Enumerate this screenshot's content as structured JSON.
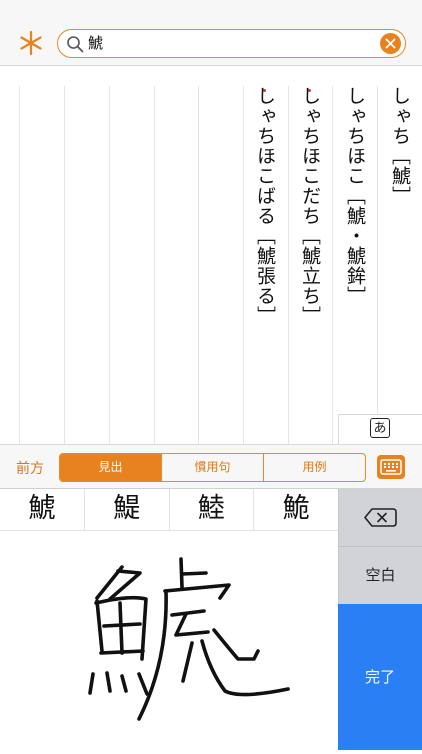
{
  "search": {
    "query": "鯱"
  },
  "entries": [
    {
      "text": "しゃち［鯱］",
      "marked": false
    },
    {
      "text": "しゃちほこ［鯱・鯱鉾］",
      "marked": false
    },
    {
      "text": "しゃちほこだち［鯱立ち］",
      "marked": true
    },
    {
      "text": "しゃちほこばる［鯱張る］",
      "marked": true
    }
  ],
  "kana_button": "あ",
  "segment": {
    "prev_label": "前方",
    "options": [
      "見出",
      "慣用句",
      "用例"
    ],
    "selected": "見出"
  },
  "candidates": [
    "鯱",
    "鯷",
    "鯥",
    "鮠"
  ],
  "keys": {
    "space": "空白",
    "done": "完了"
  },
  "colors": {
    "accent": "#e8821f",
    "done_key": "#2a7ff5",
    "key_gray": "#d1d3d9"
  }
}
